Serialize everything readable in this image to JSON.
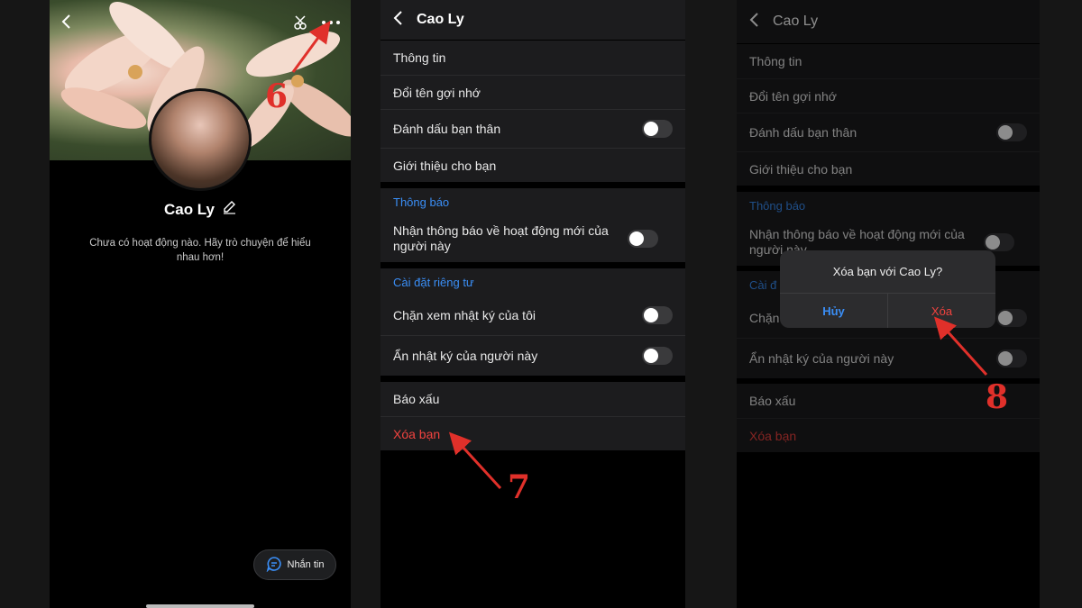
{
  "profile": {
    "name": "Cao Ly",
    "empty_text": "Chưa có hoạt động nào. Hãy trò chuyện để hiểu nhau hơn!",
    "message_button": "Nhắn tin"
  },
  "settings": {
    "title": "Cao Ly",
    "items": {
      "info": "Thông tin",
      "rename": "Đổi tên gợi nhớ",
      "close_friend": "Đánh dấu bạn thân",
      "recommend": "Giới thiệu cho bạn",
      "notif_section": "Thông báo",
      "notif_activity": "Nhận thông báo về hoạt động mới của người này",
      "privacy_section": "Cài đặt riêng tư",
      "block_diary": "Chặn xem nhật ký của tôi",
      "hide_diary": "Ẩn nhật ký của người này",
      "report": "Báo xấu",
      "unfriend": "Xóa bạn"
    },
    "toggles": {
      "close_friend": false,
      "notif_activity": false,
      "block_diary": false,
      "hide_diary": false
    }
  },
  "dialog": {
    "title": "Xóa bạn với Cao Ly?",
    "cancel": "Hủy",
    "confirm": "Xóa",
    "partial_privacy": "Cài đ",
    "partial_block": "Chặn"
  },
  "steps": {
    "s6": "6",
    "s7": "7",
    "s8": "8"
  },
  "colors": {
    "accent": "#3a8ef6",
    "danger": "#f0433f",
    "annotation": "#e0302a"
  }
}
